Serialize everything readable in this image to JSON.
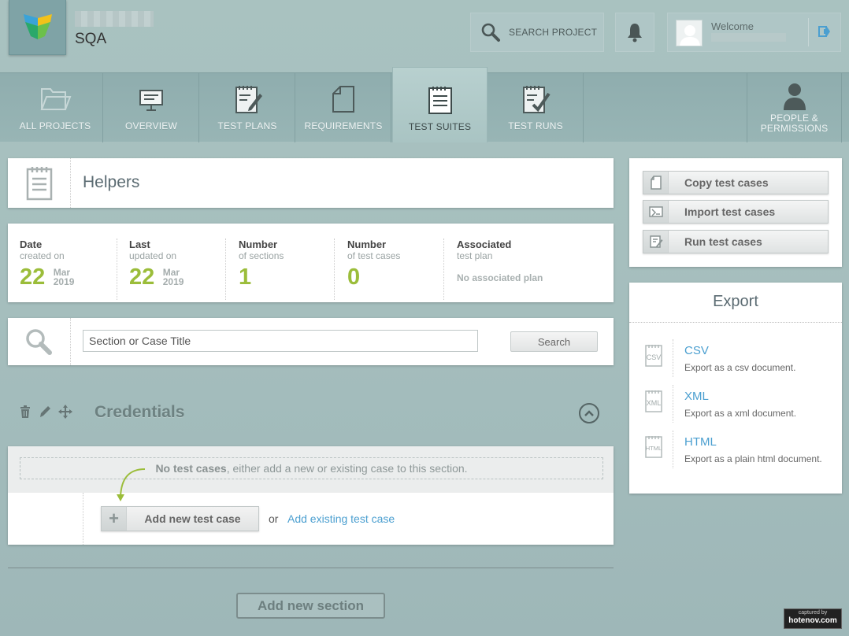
{
  "header": {
    "project_name": "SQA",
    "search_label": "SEARCH PROJECT",
    "welcome_label": "Welcome"
  },
  "nav": {
    "tabs": [
      {
        "label": "ALL PROJECTS",
        "icon": "folder-icon"
      },
      {
        "label": "OVERVIEW",
        "icon": "presentation-icon"
      },
      {
        "label": "TEST PLANS",
        "icon": "notepad-pencil-icon"
      },
      {
        "label": "REQUIREMENTS",
        "icon": "document-icon"
      },
      {
        "label": "TEST SUITES",
        "icon": "notepad-icon",
        "active": true
      },
      {
        "label": "TEST RUNS",
        "icon": "notepad-check-icon"
      }
    ],
    "people": {
      "label_line1": "PEOPLE &",
      "label_line2": "PERMISSIONS",
      "icon": "person-icon"
    }
  },
  "helpers": {
    "title": "Helpers"
  },
  "stats": [
    {
      "t1": "Date",
      "t2": "created on",
      "value": "22",
      "month": "Mar",
      "year": "2019"
    },
    {
      "t1": "Last",
      "t2": "updated on",
      "value": "22",
      "month": "Mar",
      "year": "2019"
    },
    {
      "t1": "Number",
      "t2": "of sections",
      "value": "1"
    },
    {
      "t1": "Number",
      "t2": "of test cases",
      "value": "0"
    },
    {
      "t1": "Associated",
      "t2": "test plan",
      "note": "No associated plan"
    }
  ],
  "search": {
    "placeholder": "Section or Case Title",
    "button": "Search"
  },
  "section": {
    "title": "Credentials",
    "no_cases_bold": "No test cases",
    "no_cases_rest": ", either add a new or existing case to this section.",
    "add_new_case": "Add new test case",
    "or": "or",
    "add_existing": "Add existing test case"
  },
  "add_section": "Add new section",
  "actions": [
    {
      "label": "Copy test cases",
      "icon": "copy-icon"
    },
    {
      "label": "Import test cases",
      "icon": "import-icon"
    },
    {
      "label": "Run test cases",
      "icon": "run-icon"
    }
  ],
  "export": {
    "title": "Export",
    "items": [
      {
        "name": "CSV",
        "desc": "Export as a csv document.",
        "icon_text": "CSV"
      },
      {
        "name": "XML",
        "desc": "Export as a xml document.",
        "icon_text": "XML"
      },
      {
        "name": "HTML",
        "desc": "Export as a plain html document.",
        "icon_text": "HTML"
      }
    ]
  },
  "watermark": {
    "line1": "captured by",
    "line2": "hotenov.com"
  },
  "colors": {
    "accent_green": "#9bbd3a",
    "link_blue": "#4b9fd0",
    "nav_bg": "#8fadae"
  }
}
